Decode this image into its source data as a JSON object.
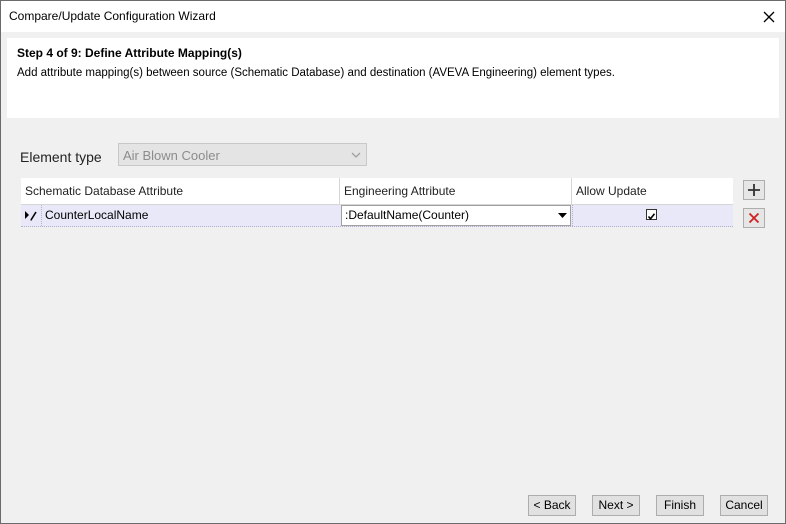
{
  "window": {
    "title": "Compare/Update Configuration Wizard"
  },
  "header": {
    "step_title": "Step 4 of 9: Define Attribute Mapping(s)",
    "step_description": "Add attribute mapping(s) between source (Schematic Database) and destination (AVEVA Engineering) element types."
  },
  "element_type": {
    "label": "Element type",
    "value": "Air Blown Cooler"
  },
  "grid": {
    "columns": [
      "Schematic Database Attribute",
      "Engineering Attribute",
      "Allow Update"
    ],
    "rows": [
      {
        "schematic_attribute": "CounterLocalName",
        "engineering_attribute": ":DefaultName(Counter)",
        "allow_update": true
      }
    ]
  },
  "icons": {
    "close": "close-icon",
    "add": "plus-icon",
    "delete": "delete-x-icon",
    "row_edit": "pencil-edit-icon"
  },
  "colors": {
    "delete_icon": "#d02020",
    "row_selected": "#e8e8f8"
  },
  "footer": {
    "back_label": "< Back",
    "next_label": "Next >",
    "finish_label": "Finish",
    "cancel_label": "Cancel"
  }
}
